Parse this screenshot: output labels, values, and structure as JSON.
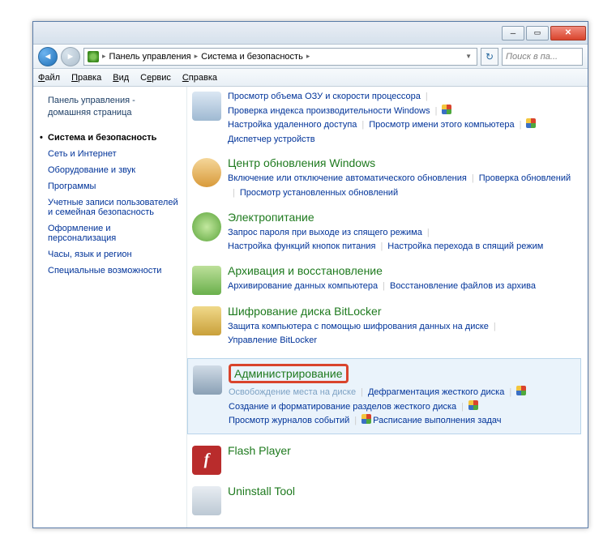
{
  "breadcrumbs": {
    "root": "Панель управления",
    "current": "Система и безопасность"
  },
  "search_placeholder": "Поиск в па...",
  "menus": {
    "file": "Файл",
    "edit": "Правка",
    "view": "Вид",
    "tools": "Сервис",
    "help": "Справка"
  },
  "sidebar": {
    "home": "Панель управления - домашняя страница",
    "items": [
      "Система и безопасность",
      "Сеть и Интернет",
      "Оборудование и звук",
      "Программы",
      "Учетные записи пользователей и семейная безопасность",
      "Оформление и персонализация",
      "Часы, язык и регион",
      "Специальные возможности"
    ]
  },
  "sections": {
    "system": {
      "links": [
        "Просмотр объема ОЗУ и скорости процессора",
        "Проверка индекса производительности Windows",
        "Настройка удаленного доступа",
        "Просмотр имени этого компьютера",
        "Диспетчер устройств"
      ]
    },
    "update": {
      "title": "Центр обновления Windows",
      "links": [
        "Включение или отключение автоматического обновления",
        "Проверка обновлений",
        "Просмотр установленных обновлений"
      ]
    },
    "power": {
      "title": "Электропитание",
      "links": [
        "Запрос пароля при выходе из спящего режима",
        "Настройка функций кнопок питания",
        "Настройка перехода в спящий режим"
      ]
    },
    "backup": {
      "title": "Архивация и восстановление",
      "links": [
        "Архивирование данных компьютера",
        "Восстановление файлов из архива"
      ]
    },
    "bitlocker": {
      "title": "Шифрование диска BitLocker",
      "links": [
        "Защита компьютера с помощью шифрования данных на диске",
        "Управление BitLocker"
      ]
    },
    "admin": {
      "title": "Администрирование",
      "links": [
        "Освобождение места на диске",
        "Дефрагментация жесткого диска",
        "Создание и форматирование разделов жесткого диска",
        "Просмотр журналов событий",
        "Расписание выполнения задач"
      ]
    },
    "flash": {
      "title": "Flash Player"
    },
    "uninstall": {
      "title": "Uninstall Tool"
    }
  }
}
